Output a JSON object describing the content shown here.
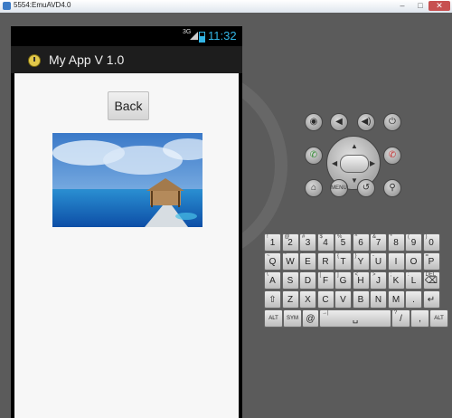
{
  "window": {
    "title": "5554:EmuAVD4.0",
    "min": "–",
    "max": "□",
    "close": "✕"
  },
  "statusbar": {
    "network": "3G",
    "time": "11:32"
  },
  "app": {
    "title": "My App V 1.0",
    "back_label": "Back"
  },
  "controls": {
    "camera": "camera-icon",
    "vol_down": "volume-down-icon",
    "vol_up": "volume-up-icon",
    "power": "power-icon",
    "call": "call-icon",
    "end_call": "end-call-icon",
    "home": "home-icon",
    "menu": "MENU",
    "back": "back-icon",
    "search": "search-icon"
  },
  "keyboard": {
    "row1": [
      {
        "k": "1",
        "s": "!"
      },
      {
        "k": "2",
        "s": "@"
      },
      {
        "k": "3",
        "s": "#"
      },
      {
        "k": "4",
        "s": "$"
      },
      {
        "k": "5",
        "s": "%"
      },
      {
        "k": "6",
        "s": "^"
      },
      {
        "k": "7",
        "s": "&"
      },
      {
        "k": "8",
        "s": "*"
      },
      {
        "k": "9",
        "s": "("
      },
      {
        "k": "0",
        "s": ")"
      }
    ],
    "row2": [
      {
        "k": "Q",
        "s": "~"
      },
      {
        "k": "W",
        "s": "\""
      },
      {
        "k": "E",
        "s": "´"
      },
      {
        "k": "R",
        "s": ""
      },
      {
        "k": "T",
        "s": "{"
      },
      {
        "k": "Y",
        "s": "}"
      },
      {
        "k": "U",
        "s": "-"
      },
      {
        "k": "I",
        "s": ""
      },
      {
        "k": "O",
        "s": ""
      },
      {
        "k": "P",
        "s": "="
      }
    ],
    "row3": [
      {
        "k": "A",
        "s": "\\"
      },
      {
        "k": "S",
        "s": ""
      },
      {
        "k": "D",
        "s": "`"
      },
      {
        "k": "F",
        "s": "["
      },
      {
        "k": "G",
        "s": "]"
      },
      {
        "k": "H",
        "s": "<"
      },
      {
        "k": "J",
        "s": ">"
      },
      {
        "k": "K",
        "s": ";"
      },
      {
        "k": "L",
        "s": ":"
      },
      {
        "k": "⌫",
        "s": "DEL"
      }
    ],
    "row4": [
      {
        "k": "⇧",
        "s": ""
      },
      {
        "k": "Z",
        "s": ""
      },
      {
        "k": "X",
        "s": ""
      },
      {
        "k": "C",
        "s": ""
      },
      {
        "k": "V",
        "s": ""
      },
      {
        "k": "B",
        "s": ""
      },
      {
        "k": "N",
        "s": ""
      },
      {
        "k": "M",
        "s": ""
      },
      {
        "k": ".",
        "s": ""
      },
      {
        "k": "↵",
        "s": ""
      }
    ],
    "row5": [
      {
        "k": "ALT",
        "s": ""
      },
      {
        "k": "SYM",
        "s": ""
      },
      {
        "k": "@",
        "s": ""
      },
      {
        "k": "␣",
        "s": "→|"
      },
      {
        "k": "/",
        "s": "?"
      },
      {
        "k": ",",
        "s": ""
      },
      {
        "k": "ALT",
        "s": ""
      }
    ]
  }
}
